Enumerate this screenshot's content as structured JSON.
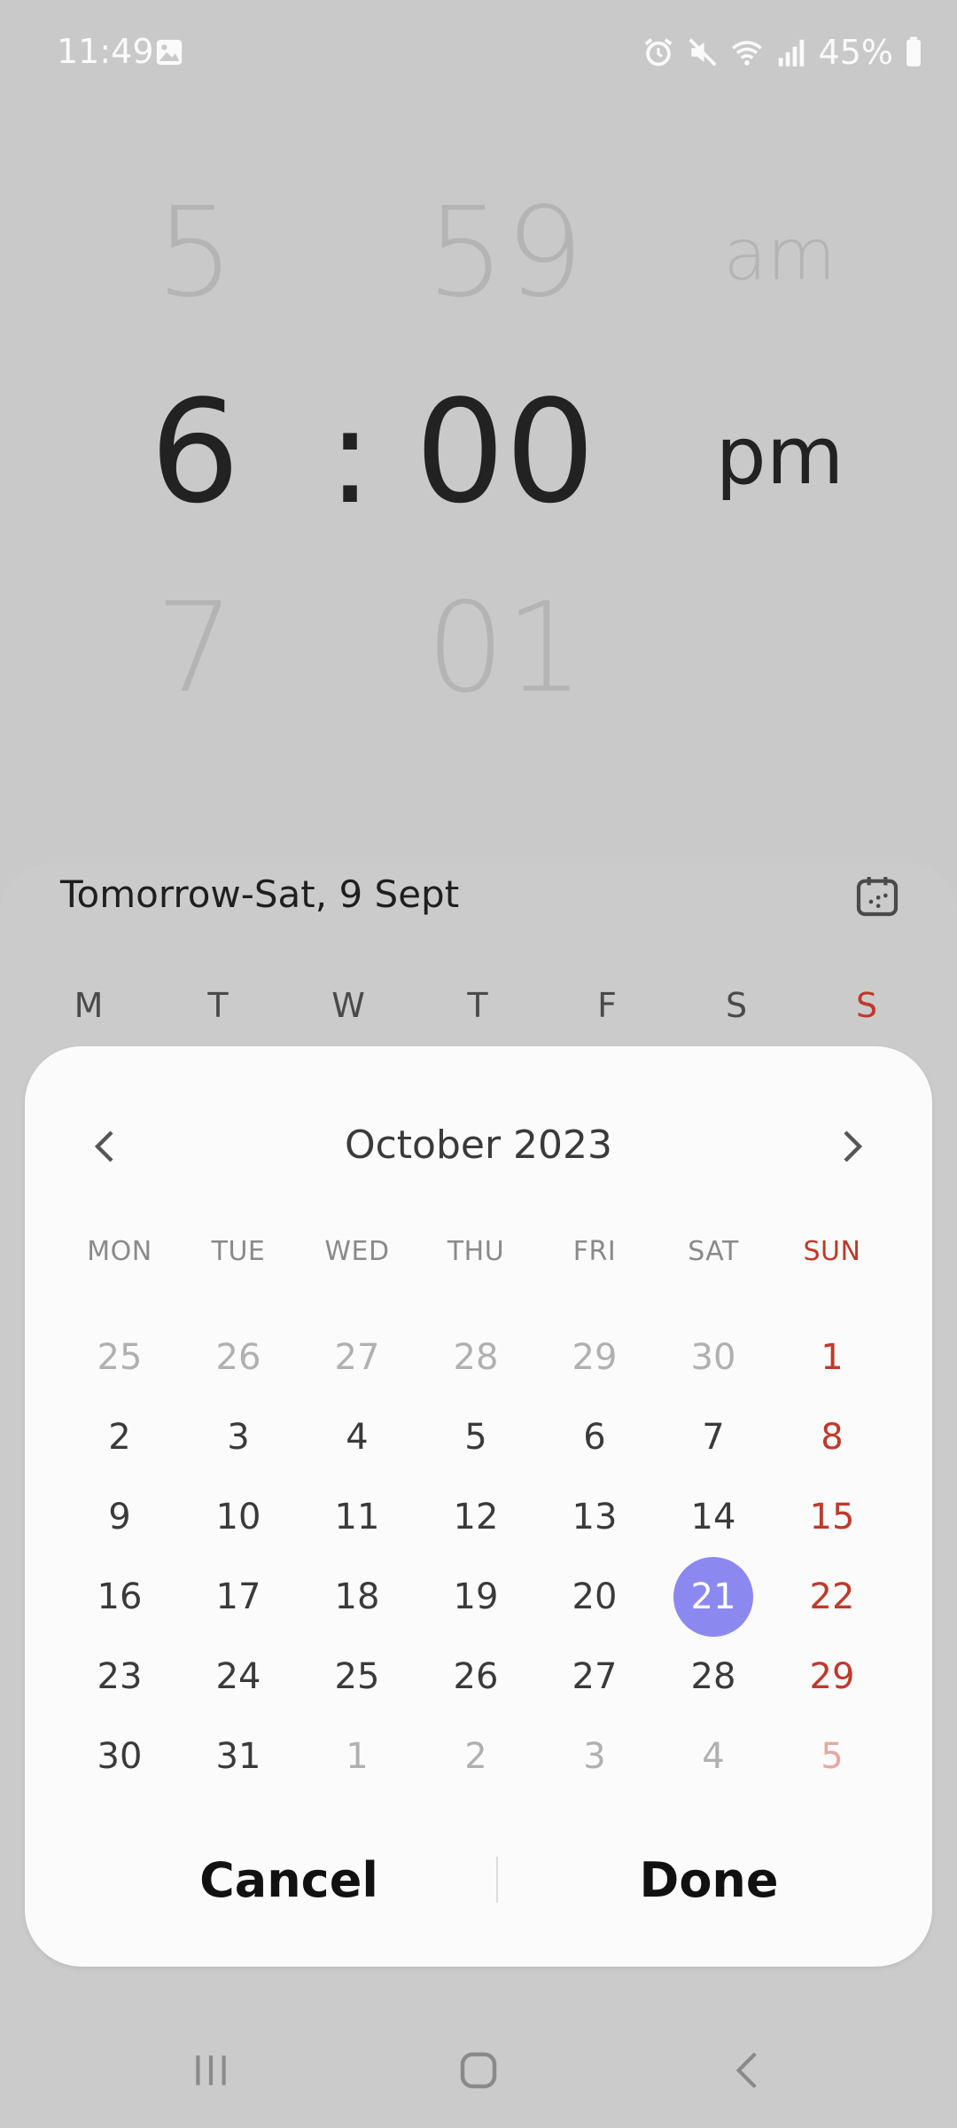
{
  "status_bar": {
    "time": "11:49",
    "battery": "45%",
    "icons": [
      "image-icon",
      "alarm-icon",
      "mute-icon",
      "wifi-icon",
      "signal-icon",
      "battery-icon"
    ]
  },
  "time_picker": {
    "hour_prev": "5",
    "hour": "6",
    "hour_next": "7",
    "separator": ":",
    "minute_prev": "59",
    "minute": "00",
    "minute_next": "01",
    "ampm_prev": "am",
    "ampm": "pm"
  },
  "schedule": {
    "date_label": "Tomorrow-Sat, 9 Sept",
    "week_letters": [
      "M",
      "T",
      "W",
      "T",
      "F",
      "S",
      "S"
    ]
  },
  "calendar": {
    "month_title": "October 2023",
    "weekdays": [
      "MON",
      "TUE",
      "WED",
      "THU",
      "FRI",
      "SAT",
      "SUN"
    ],
    "weeks": [
      [
        "25",
        "26",
        "27",
        "28",
        "29",
        "30",
        "1"
      ],
      [
        "2",
        "3",
        "4",
        "5",
        "6",
        "7",
        "8"
      ],
      [
        "9",
        "10",
        "11",
        "12",
        "13",
        "14",
        "15"
      ],
      [
        "16",
        "17",
        "18",
        "19",
        "20",
        "21",
        "22"
      ],
      [
        "23",
        "24",
        "25",
        "26",
        "27",
        "28",
        "29"
      ],
      [
        "30",
        "31",
        "1",
        "2",
        "3",
        "4",
        "5"
      ]
    ],
    "selected": "21",
    "accent_color": "#8b89f0",
    "sunday_color": "#c0392b"
  },
  "dialog": {
    "cancel_label": "Cancel",
    "done_label": "Done"
  }
}
